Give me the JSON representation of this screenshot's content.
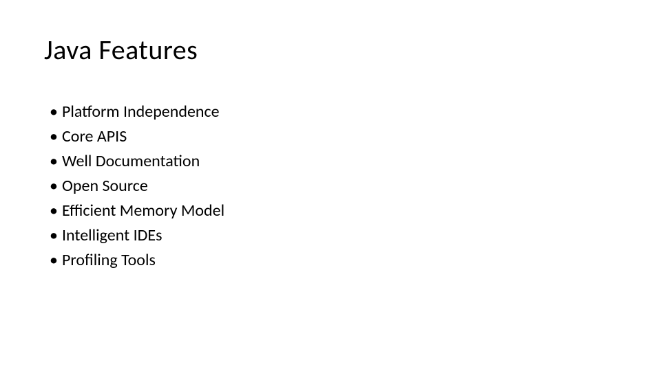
{
  "slide": {
    "title": "Java Features",
    "bullets": [
      "Platform Independence",
      "Core APIS",
      "Well Documentation",
      "Open Source",
      "Efficient Memory Model",
      "Intelligent IDEs",
      "Profiling Tools"
    ]
  }
}
